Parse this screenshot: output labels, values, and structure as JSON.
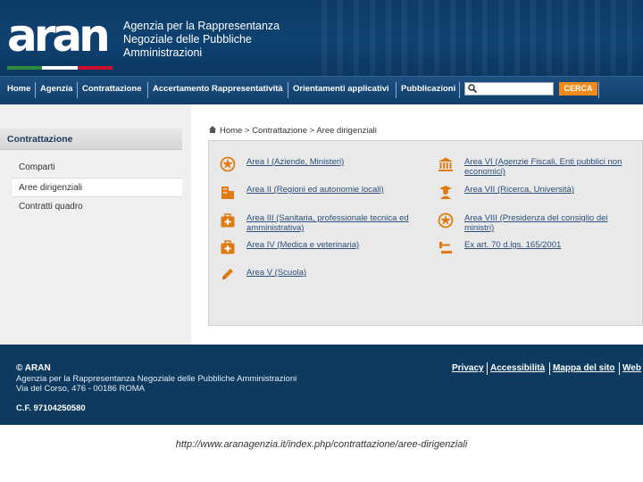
{
  "header": {
    "logo_text": "aran",
    "agency_lines": [
      "Agenzia per la Rappresentanza",
      "Negoziale delle Pubbliche",
      "Amministrazioni"
    ],
    "flag_colors": [
      "#2e8b3e",
      "#ffffff",
      "#c8102e"
    ]
  },
  "nav": {
    "items": [
      "Home",
      "Agenzia",
      "Contrattazione",
      "Accertamento Rappresentatività",
      "Orientamenti applicativi",
      "Pubblicazioni"
    ],
    "search_placeholder": "",
    "search_button": "CERCA"
  },
  "sidebar": {
    "title": "Contrattazione",
    "items": [
      "Comparti",
      "Aree dirigenziali",
      "Contratti quadro"
    ],
    "active_index": 1
  },
  "breadcrumb": {
    "home": "Home",
    "sep": ">",
    "section": "Contrattazione",
    "current": "Aree dirigenziali"
  },
  "areas": {
    "left": [
      {
        "label": "Area I (Aziende, Ministeri)",
        "icon": "emblem-icon"
      },
      {
        "label": "Area II (Regioni ed autonomie locali)",
        "icon": "building-icon"
      },
      {
        "label": "Area III (Sanitaria, professionale tecnica ed amministrativa)",
        "icon": "medical-kit-icon"
      },
      {
        "label": "Area IV (Medica e veterinaria)",
        "icon": "medical-kit-icon"
      },
      {
        "label": "Area V (Scuola)",
        "icon": "pencil-icon"
      }
    ],
    "right": [
      {
        "label": "Area VI (Agenzie Fiscali, Enti pubblici non economici)",
        "icon": "bank-icon"
      },
      {
        "label": "Area VII (Ricerca, Università)",
        "icon": "graduate-icon"
      },
      {
        "label": "Area VIII (Presidenza del consiglio dei ministri)",
        "icon": "emblem-icon"
      },
      {
        "label": "Ex art. 70 d.lgs. 165/2001",
        "icon": "gavel-icon"
      }
    ]
  },
  "footer": {
    "copyright": "© ARAN",
    "line1": "Agenzia per la Rappresentanza Negoziale delle Pubbliche Amministrazioni",
    "line2": "Via del Corso, 476 - 00186 ROMA",
    "cf": "C.F. 97104250580",
    "links": [
      "Privacy",
      "Accessibilità",
      "Mappa del sito",
      "Web"
    ]
  },
  "url": "http://www.aranagenzia.it/index.php/contrattazione/aree-dirigenziali",
  "colors": {
    "header_bg": "#0f4272",
    "nav_bg": "#164878",
    "accent": "#f08a1c",
    "icon": "#e07b12",
    "link": "#2a4f7a",
    "footer_bg": "#0e3a5f"
  }
}
